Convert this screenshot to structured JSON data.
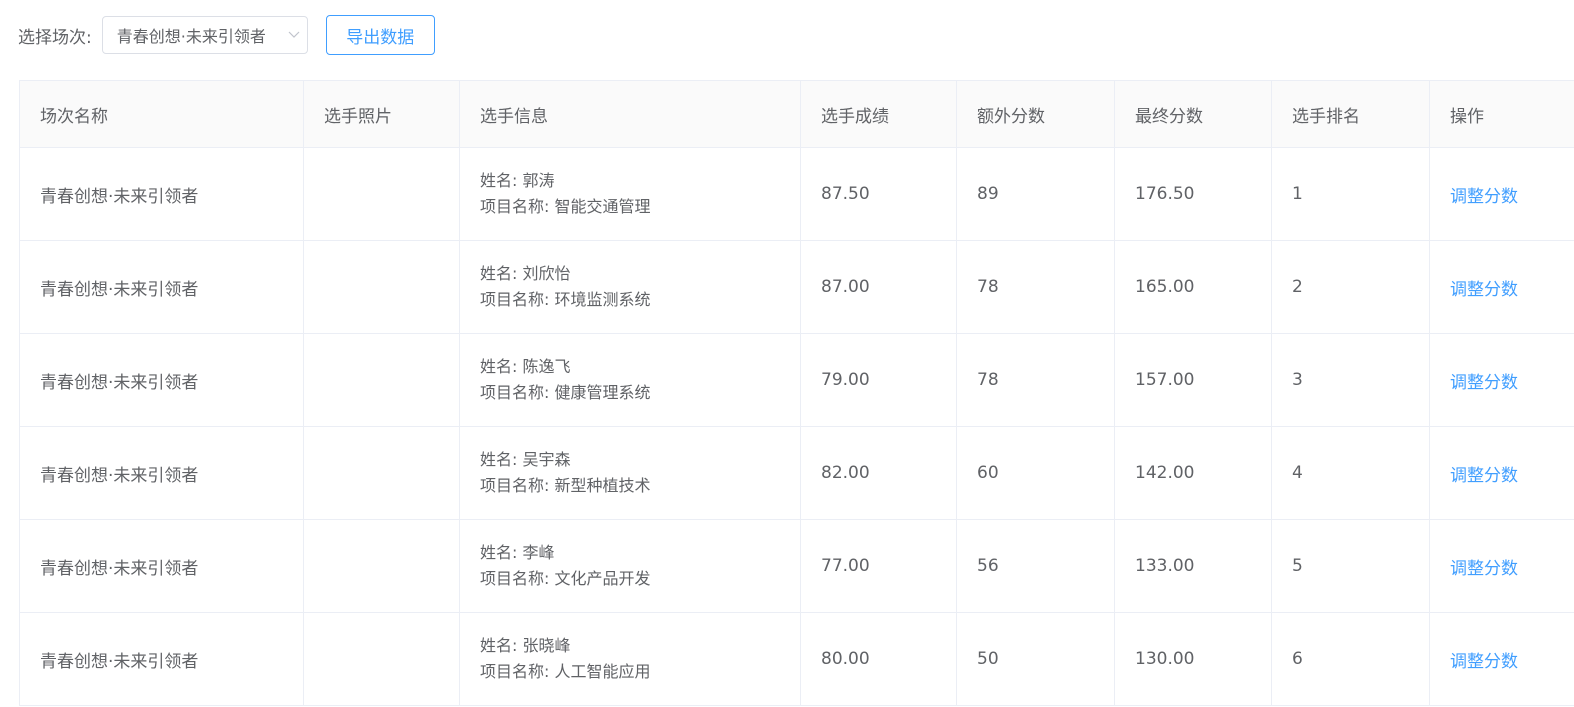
{
  "filter": {
    "label": "选择场次:",
    "selected": "青春创想·未来引领者"
  },
  "toolbar": {
    "export_label": "导出数据"
  },
  "table": {
    "headers": [
      "场次名称",
      "选手照片",
      "选手信息",
      "选手成绩",
      "额外分数",
      "最终分数",
      "选手排名",
      "操作"
    ],
    "rows": [
      {
        "session": "青春创想·未来引领者",
        "name": "姓名: 郭涛",
        "project": "项目名称: 智能交通管理",
        "score": "87.50",
        "extra": "89",
        "final": "176.50",
        "rank": "1",
        "action": "调整分数"
      },
      {
        "session": "青春创想·未来引领者",
        "name": "姓名: 刘欣怡",
        "project": "项目名称: 环境监测系统",
        "score": "87.00",
        "extra": "78",
        "final": "165.00",
        "rank": "2",
        "action": "调整分数"
      },
      {
        "session": "青春创想·未来引领者",
        "name": "姓名: 陈逸飞",
        "project": "项目名称: 健康管理系统",
        "score": "79.00",
        "extra": "78",
        "final": "157.00",
        "rank": "3",
        "action": "调整分数"
      },
      {
        "session": "青春创想·未来引领者",
        "name": "姓名: 吴宇森",
        "project": "项目名称: 新型种植技术",
        "score": "82.00",
        "extra": "60",
        "final": "142.00",
        "rank": "4",
        "action": "调整分数"
      },
      {
        "session": "青春创想·未来引领者",
        "name": "姓名: 李峰",
        "project": "项目名称: 文化产品开发",
        "score": "77.00",
        "extra": "56",
        "final": "133.00",
        "rank": "5",
        "action": "调整分数"
      },
      {
        "session": "青春创想·未来引领者",
        "name": "姓名: 张晓峰",
        "project": "项目名称: 人工智能应用",
        "score": "80.00",
        "extra": "50",
        "final": "130.00",
        "rank": "6",
        "action": "调整分数"
      }
    ]
  },
  "colors": {
    "accent": "#409eff",
    "text": "#606266",
    "border": "#ebeef5",
    "header_bg": "#fafafa"
  },
  "icons": {
    "select_arrow": "chevron-down-icon"
  }
}
